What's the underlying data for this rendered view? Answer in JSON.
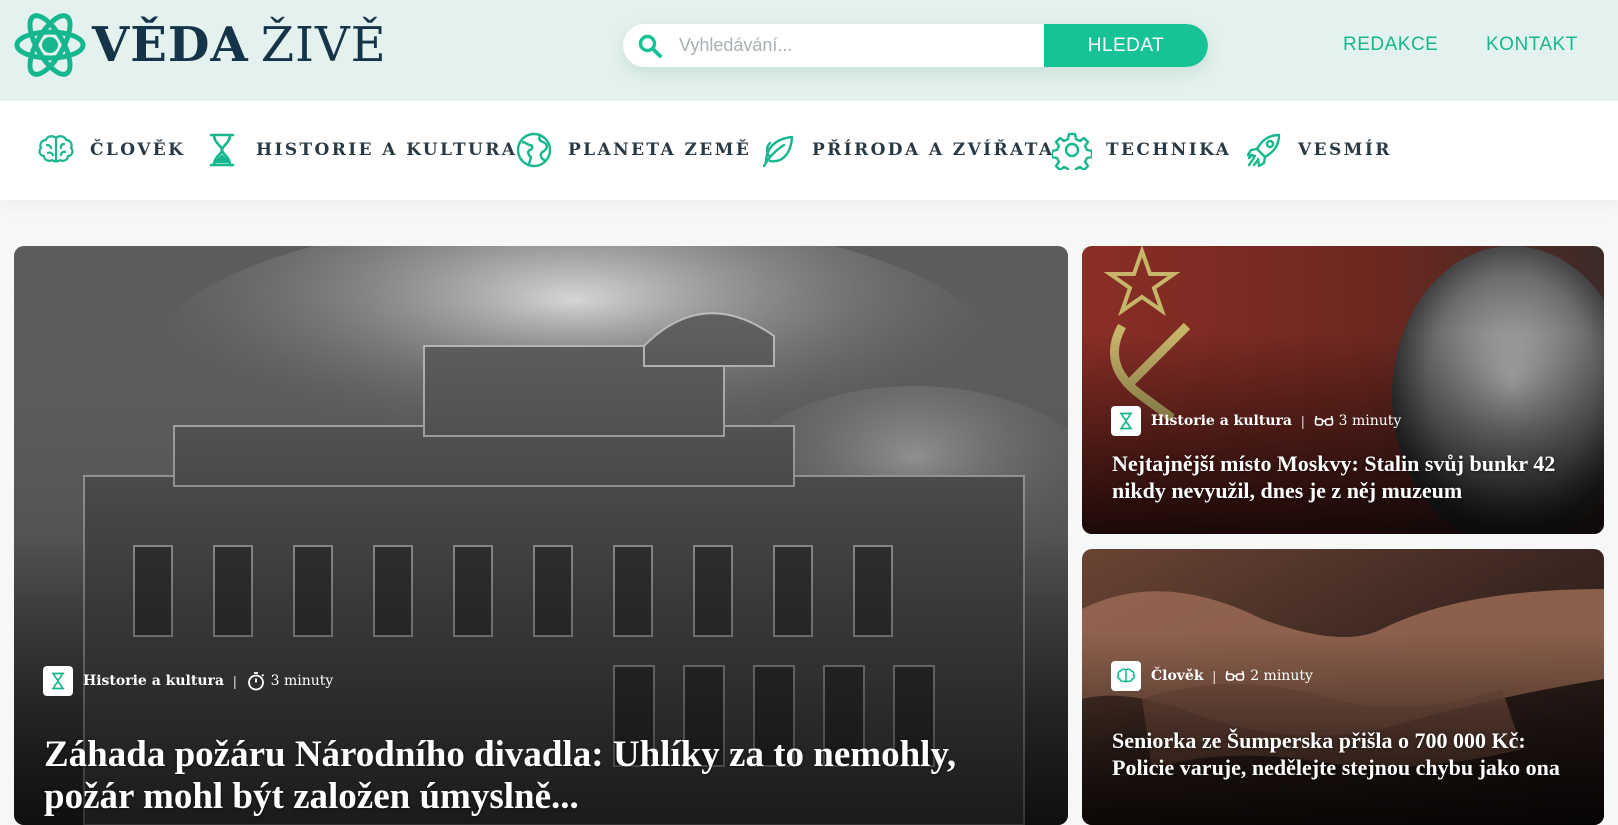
{
  "logo": {
    "word1": "VĚDA",
    "word2": "ŽIVĚ",
    "icon": "atom-icon",
    "color": "#16b78f"
  },
  "search": {
    "placeholder": "Vyhledávání...",
    "button_label": "HLEDAT"
  },
  "top_links": {
    "redakce": "REDAKCE",
    "kontakt": "KONTAKT"
  },
  "categories": [
    {
      "label": "ČLOVĚK",
      "icon": "brain-icon"
    },
    {
      "label": "HISTORIE A KULTURA",
      "icon": "hourglass-icon"
    },
    {
      "label": "PLANETA ZEMĚ",
      "icon": "globe-icon"
    },
    {
      "label": "PŘÍRODA A ZVÍŘATA",
      "icon": "leaf-icon"
    },
    {
      "label": "TECHNIKA",
      "icon": "gear-icon"
    },
    {
      "label": "VESMÍR",
      "icon": "rocket-icon"
    }
  ],
  "articles": {
    "main": {
      "category": "Historie a kultura",
      "category_icon": "hourglass-icon",
      "time_icon": "stopwatch-icon",
      "read_time": "3 minuty",
      "title": "Záhada požáru Národního divadla: Uhlíky za to nemohly, požár mohl být založen úmyslně...",
      "image": "engraving of burning National Theatre"
    },
    "side1": {
      "category": "Historie a kultura",
      "category_icon": "hourglass-icon",
      "time_icon": "glasses-icon",
      "read_time": "3 minuty",
      "title": "Nejtajnější místo Moskvy: Stalin svůj bunkr 42 nikdy nevyužil, dnes je z něj muzeum",
      "image": "Soviet flag and Stalin bust"
    },
    "side2": {
      "category": "Člověk",
      "category_icon": "brain-icon",
      "time_icon": "glasses-icon",
      "read_time": "2 minuty",
      "title": "Seniorka ze Šumperska přišla o 700 000 Kč: Policie varuje, nedělejte stejnou chybu jako ona",
      "image": "elderly hands"
    }
  },
  "colors": {
    "accent": "#16c296",
    "header_bg": "#e4f2ef",
    "text_dark": "#163447"
  }
}
